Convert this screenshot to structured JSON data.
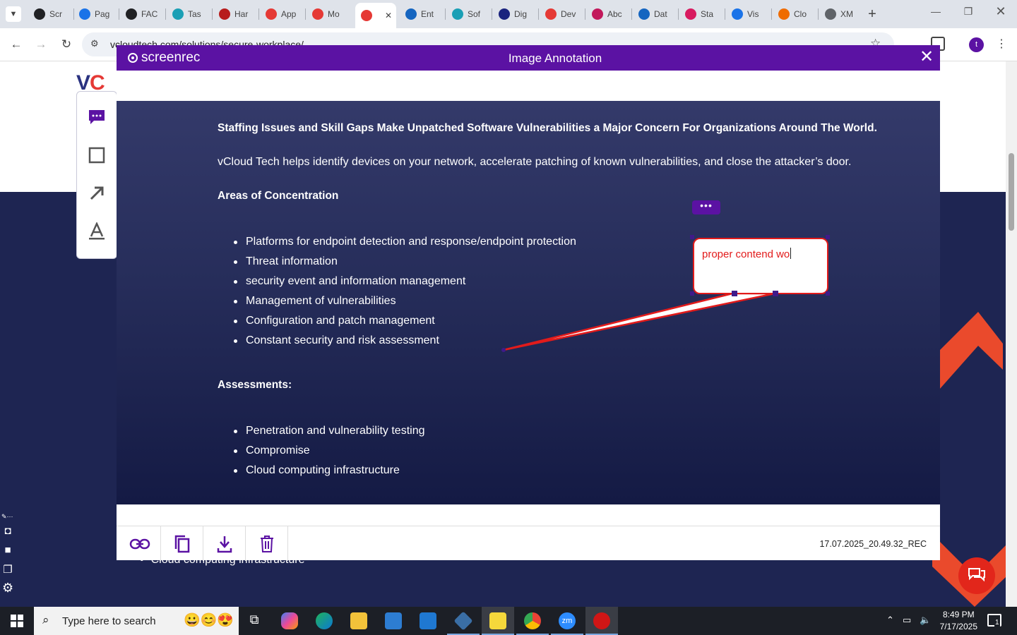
{
  "browser": {
    "tabs": [
      {
        "label": "Scr",
        "color": "#202124"
      },
      {
        "label": "Pag",
        "color": "#1a73e8"
      },
      {
        "label": "FAC",
        "color": "#202124"
      },
      {
        "label": "Tas",
        "color": "#1a9fb5"
      },
      {
        "label": "Har",
        "color": "#b71c1c"
      },
      {
        "label": "App",
        "color": "#e53935"
      },
      {
        "label": "Mo",
        "color": "#e53935"
      },
      {
        "label": "",
        "color": "#e53935",
        "active": true
      },
      {
        "label": "Ent",
        "color": "#1565c0"
      },
      {
        "label": "Sof",
        "color": "#1a9fb5"
      },
      {
        "label": "Dig",
        "color": "#1a237e"
      },
      {
        "label": "Dev",
        "color": "#e53935"
      },
      {
        "label": "Abc",
        "color": "#c2185b"
      },
      {
        "label": "Dat",
        "color": "#1565c0"
      },
      {
        "label": "Sta",
        "color": "#d81b60"
      },
      {
        "label": "Vis",
        "color": "#1a73e8"
      },
      {
        "label": "Clo",
        "color": "#ef6c00"
      },
      {
        "label": "XM",
        "color": "#5f6368"
      }
    ],
    "url": "vcloudtech.com/solutions/secure-workplace/"
  },
  "page": {
    "logo_main": "VC",
    "background_item": "Cloud computing infrastructure"
  },
  "modal": {
    "brand": "screenrec",
    "title": "Image Annotation",
    "headline": "Staffing Issues and Skill Gaps Make Unpatched Software Vulnerabilities a Major Concern For Organizations Around The World.",
    "intro": "vCloud Tech helps identify devices on your network, accelerate patching of known vulnerabilities, and close the attacker’s door.",
    "areas_title": "Areas of Concentration",
    "areas": [
      "Platforms for endpoint detection and response/endpoint protection",
      "Threat information",
      "security event and information management",
      "Management of vulnerabilities",
      "Configuration and patch management",
      "Constant security and risk assessment"
    ],
    "assess_title": "Assessments:",
    "assessments": [
      "Penetration and vulnerability testing",
      "Compromise",
      "Cloud computing infrastructure"
    ],
    "annotation": {
      "more_label": "•••",
      "text": "proper contend wo",
      "color": "#e21b1b"
    },
    "filename": "17.07.2025_20.49.32_REC"
  },
  "taskbar": {
    "search_placeholder": "Type here to search",
    "time": "8:49 PM",
    "date": "7/17/2025",
    "notif_count": "1"
  }
}
